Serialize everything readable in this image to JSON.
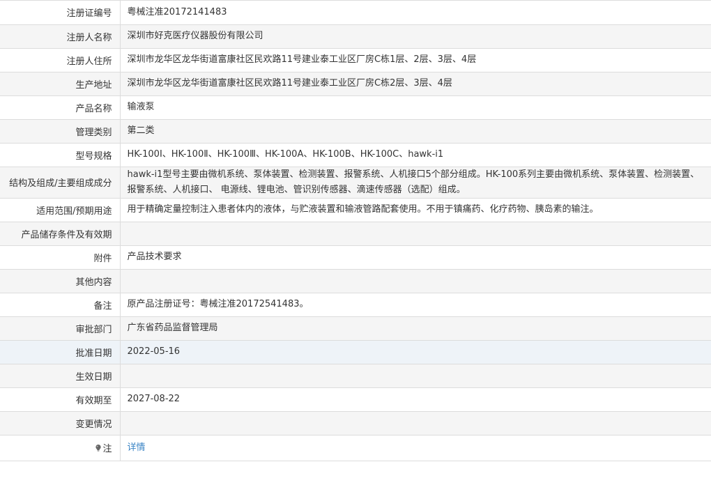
{
  "rows": [
    {
      "label": "注册证编号",
      "value": "粤械注准20172141483"
    },
    {
      "label": "注册人名称",
      "value": "深圳市好克医疗仪器股份有限公司"
    },
    {
      "label": "注册人住所",
      "value": "深圳市龙华区龙华街道富康社区民欢路11号建业泰工业区厂房C栋1层、2层、3层、4层"
    },
    {
      "label": "生产地址",
      "value": "深圳市龙华区龙华街道富康社区民欢路11号建业泰工业区厂房C栋2层、3层、4层"
    },
    {
      "label": "产品名称",
      "value": "输液泵"
    },
    {
      "label": "管理类别",
      "value": "第二类"
    },
    {
      "label": "型号规格",
      "value": "HK-100Ⅰ、HK-100Ⅱ、HK-100Ⅲ、HK-100A、HK-100B、HK-100C、hawk-i1"
    },
    {
      "label": "结构及组成/主要组成成分",
      "value": "hawk-i1型号主要由微机系统、泵体装置、检测装置、报警系统、人机接口5个部分组成。HK-100系列主要由微机系统、泵体装置、检测装置、报警系统、人机接口、 电源线、锂电池、管识别传感器、滴速传感器（选配）组成。"
    },
    {
      "label": "适用范围/预期用途",
      "value": "用于精确定量控制注入患者体内的液体，与贮液装置和输液管路配套使用。不用于镇痛药、化疗药物、胰岛素的输注。"
    },
    {
      "label": "产品储存条件及有效期",
      "value": ""
    },
    {
      "label": "附件",
      "value": "产品技术要求"
    },
    {
      "label": "其他内容",
      "value": ""
    },
    {
      "label": "备注",
      "value": "原产品注册证号：粤械注准20172541483。"
    },
    {
      "label": "审批部门",
      "value": "广东省药品监督管理局"
    },
    {
      "label": "批准日期",
      "value": "2022-05-16"
    },
    {
      "label": "生效日期",
      "value": ""
    },
    {
      "label": "有效期至",
      "value": "2027-08-22"
    },
    {
      "label": "变更情况",
      "value": ""
    }
  ],
  "note": {
    "label": "注",
    "icon": "lightbulb-icon",
    "link_text": "详情"
  },
  "colors": {
    "link": "#3a84c5",
    "alt_row": "#f5f5f5",
    "hover_row": "#eef3f8",
    "border": "#dcdcdc"
  }
}
